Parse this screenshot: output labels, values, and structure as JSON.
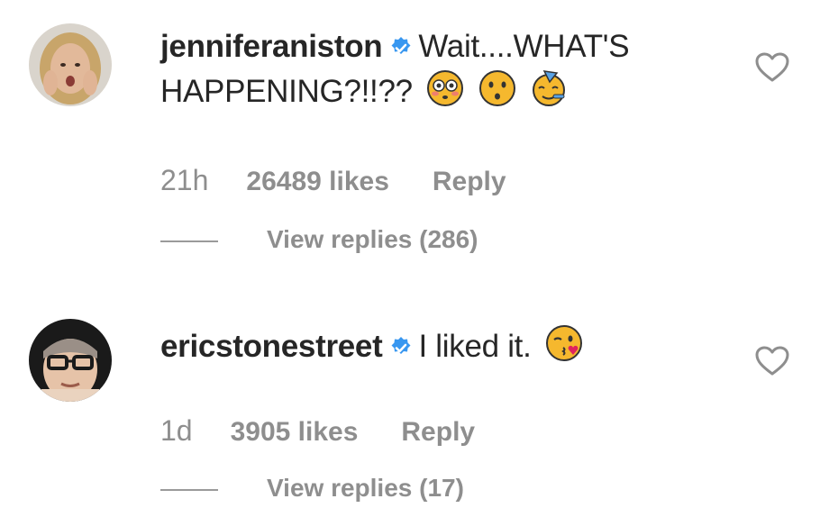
{
  "comments": [
    {
      "username": "jenniferaniston",
      "verified": true,
      "text_line1": "Wait....WHAT'S",
      "text_line2": "HAPPENING?!!??",
      "emojis": [
        "flushed-face",
        "hushed-face",
        "partying-face"
      ],
      "time": "21h",
      "likes": "26489 likes",
      "reply_label": "Reply",
      "view_replies": "View replies (286)"
    },
    {
      "username": "ericstonestreet",
      "verified": true,
      "text_line1": "I liked it.",
      "emojis": [
        "kissing-winking-face"
      ],
      "time": "1d",
      "likes": "3905 likes",
      "reply_label": "Reply",
      "view_replies": "View replies (17)"
    }
  ],
  "colors": {
    "text": "#262626",
    "secondary": "#8e8e8e",
    "verified_blue": "#3897f0",
    "emoji_yellow": "#f5b82e"
  },
  "icons": [
    "verified-badge-icon",
    "heart-outline-icon"
  ]
}
